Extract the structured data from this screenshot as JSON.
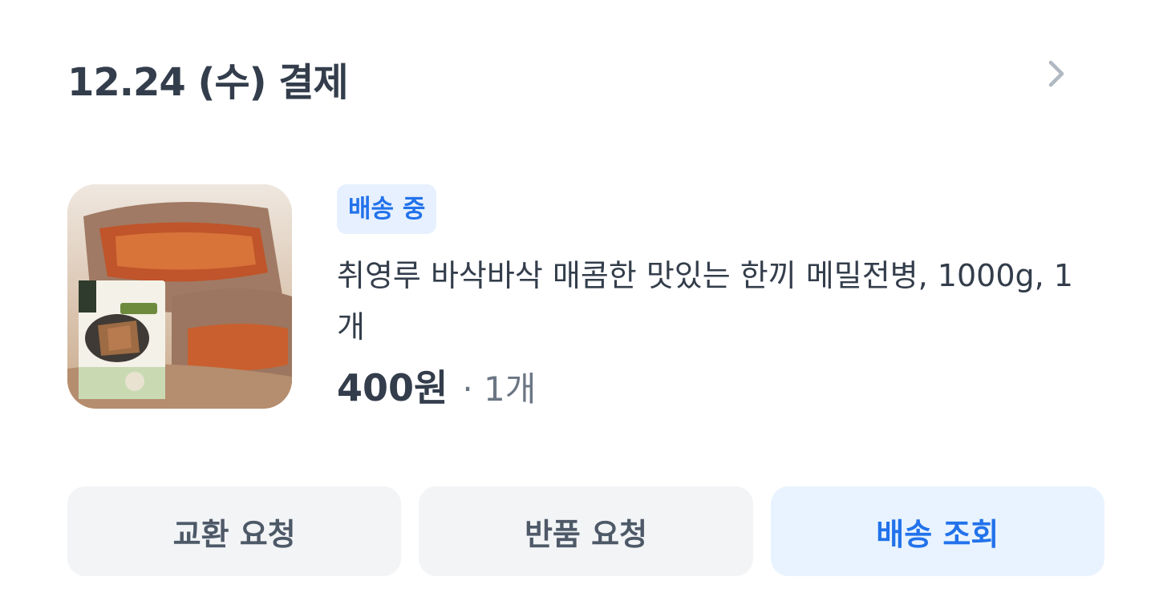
{
  "order": {
    "date_title": "12.24 (수) 결제"
  },
  "item": {
    "status_badge": "배송 중",
    "status_color": "#2272eb",
    "name": "취영루 바삭바삭 매콤한 맛있는 한끼 메밀전병, 1000g, 1개",
    "price": "400원",
    "quantity": "· 1개",
    "image_icon": "product-photo"
  },
  "actions": {
    "exchange_label": "교환 요청",
    "return_label": "반품 요청",
    "track_label": "배송 조회"
  }
}
